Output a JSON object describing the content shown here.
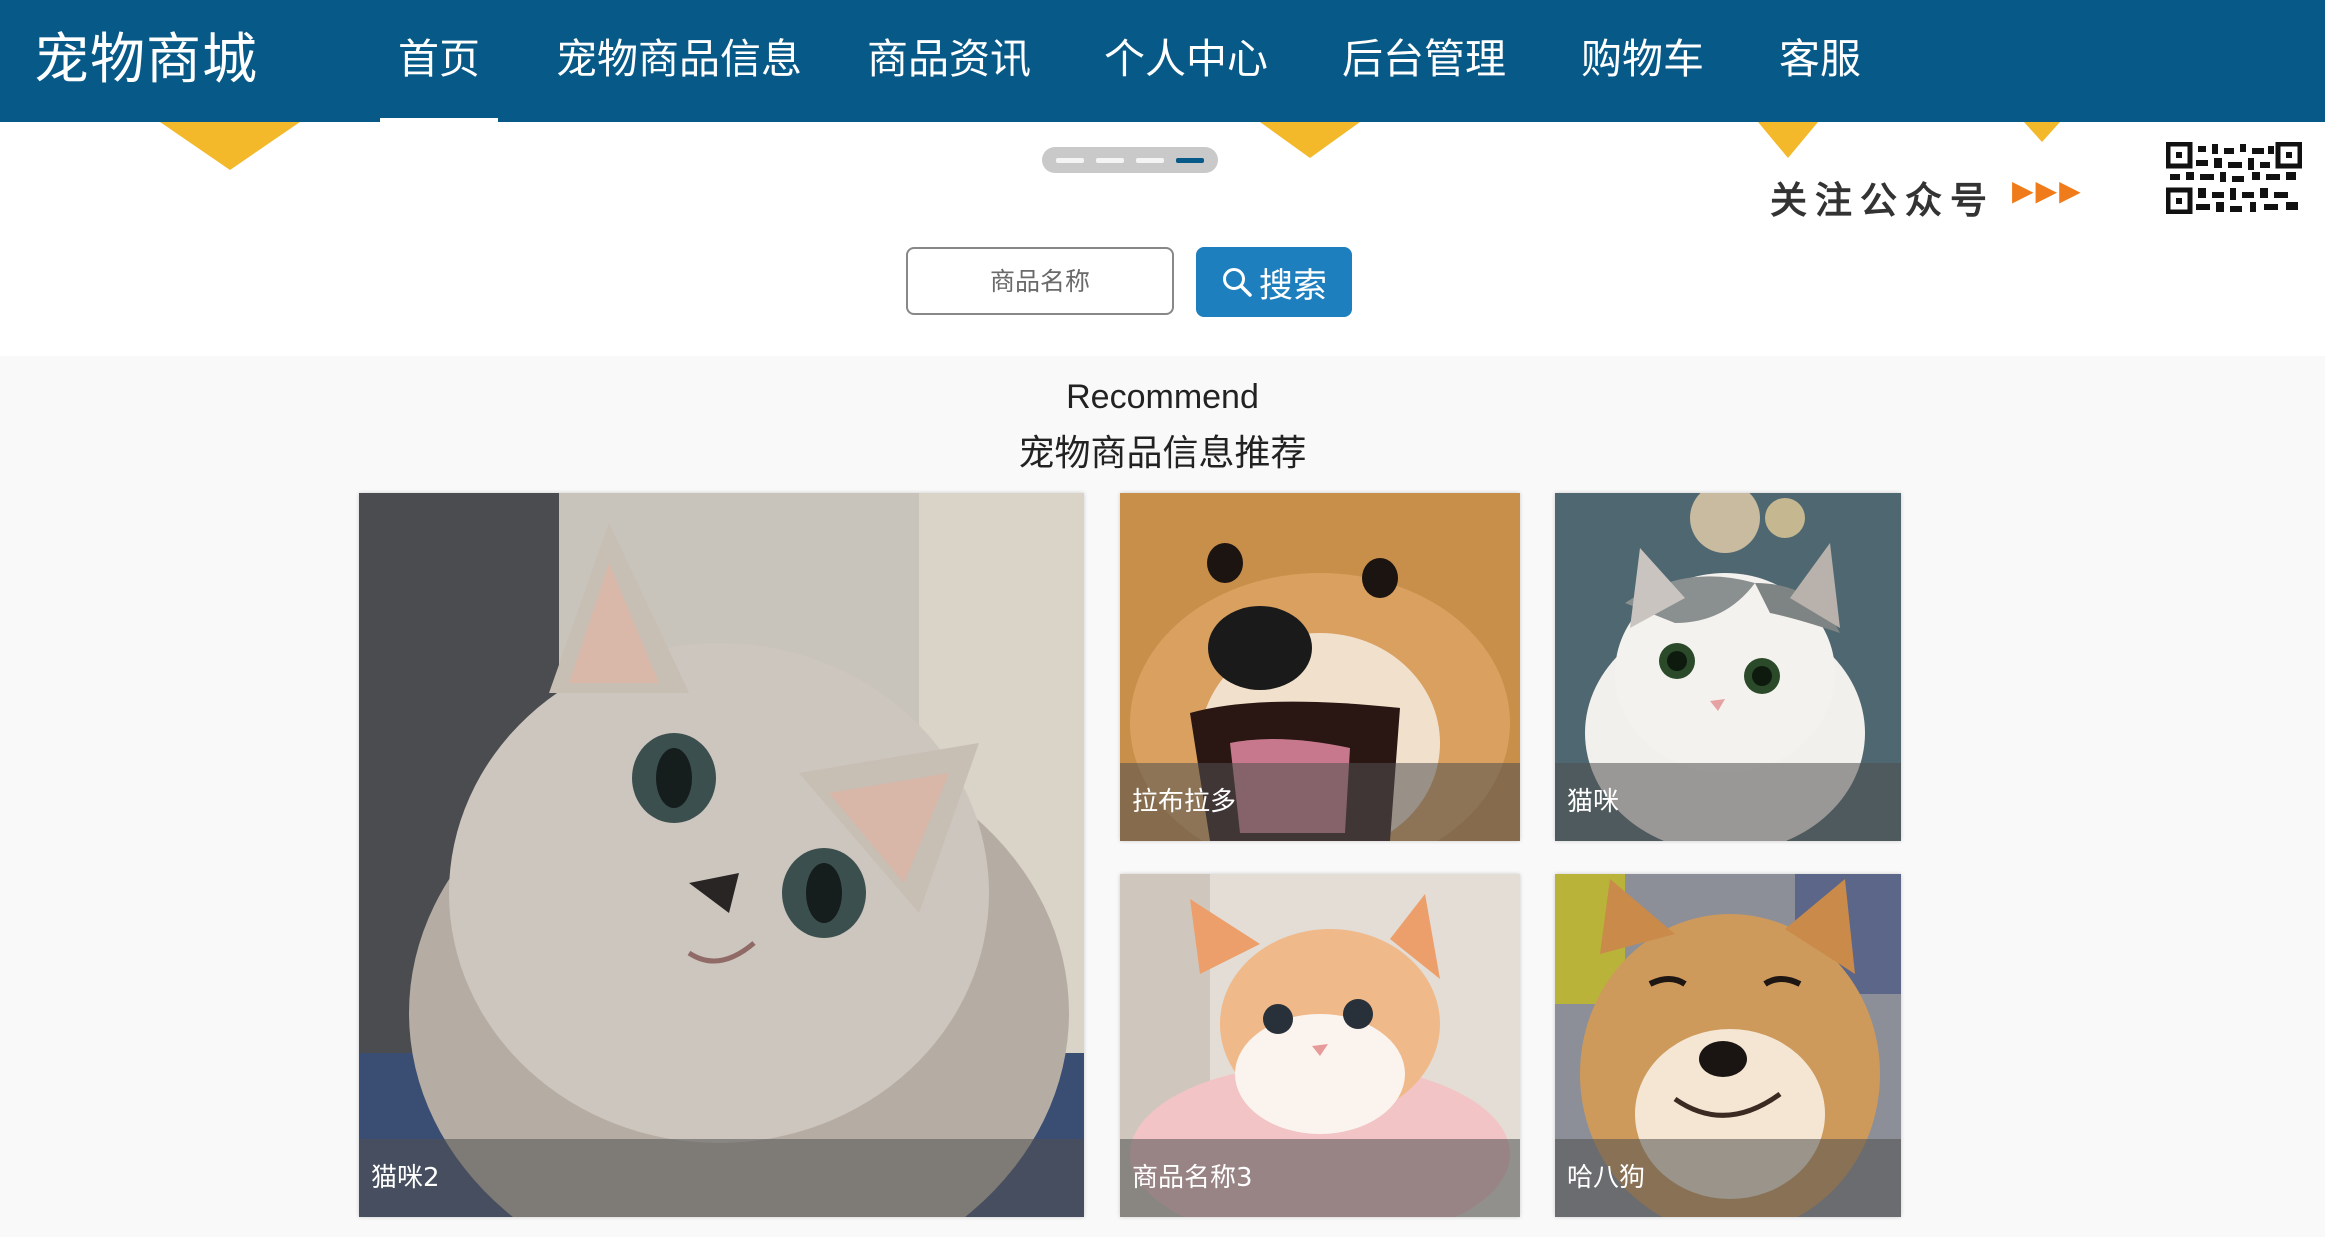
{
  "header": {
    "brand": "宠物商城",
    "nav": [
      {
        "label": "首页",
        "active": true
      },
      {
        "label": "宠物商品信息"
      },
      {
        "label": "商品资讯"
      },
      {
        "label": "个人中心"
      },
      {
        "label": "后台管理"
      },
      {
        "label": "购物车"
      },
      {
        "label": "客服"
      }
    ]
  },
  "banner": {
    "follow_text": "关注公众号",
    "arrows": "▶▶▶",
    "qr_icon": "qr-code-icon",
    "carousel_active_index": 3,
    "carousel_count": 4
  },
  "search": {
    "placeholder": "商品名称",
    "button_label": "搜索",
    "button_icon": "search-icon"
  },
  "recommend": {
    "title_en": "Recommend",
    "title_cn": "宠物商品信息推荐",
    "items": [
      {
        "name": "猫咪2"
      },
      {
        "name": "拉布拉多"
      },
      {
        "name": "猫咪"
      },
      {
        "name": "商品名称3"
      },
      {
        "name": "哈八狗"
      }
    ]
  },
  "colors": {
    "header_bg": "#075987",
    "search_button": "#1d7fbd",
    "accent_yellow": "#f3b92a",
    "arrow_orange": "#ef7b1a"
  }
}
